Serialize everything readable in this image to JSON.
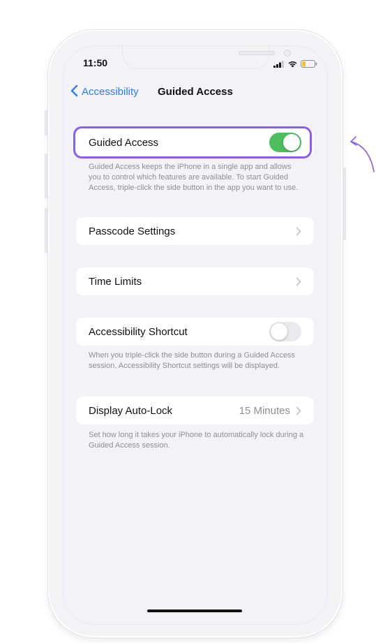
{
  "status_bar": {
    "time": "11:50"
  },
  "nav": {
    "back_label": "Accessibility",
    "title": "Guided Access"
  },
  "settings": {
    "guided_access": {
      "label": "Guided Access",
      "enabled": true,
      "footer": "Guided Access keeps the iPhone in a single app and allows you to control which features are available. To start Guided Access, triple-click the side button in the app you want to use."
    },
    "passcode_settings": {
      "label": "Passcode Settings"
    },
    "time_limits": {
      "label": "Time Limits"
    },
    "accessibility_shortcut": {
      "label": "Accessibility Shortcut",
      "enabled": false,
      "footer": "When you triple-click the side button during a Guided Access session, Accessibility Shortcut settings will be displayed."
    },
    "display_auto_lock": {
      "label": "Display Auto-Lock",
      "value": "15 Minutes",
      "footer": "Set how long it takes your iPhone to automatically lock during a Guided Access session."
    }
  },
  "colors": {
    "accent_link": "#2f7df6",
    "toggle_on": "#4cbf5c",
    "highlight": "#8b5cf6",
    "annotation": "#8b5cf6"
  },
  "icons": {
    "back": "chevron-left-icon",
    "disclosure": "chevron-right-icon",
    "signal": "cellular-signal-icon",
    "wifi": "wifi-icon",
    "battery": "battery-icon",
    "annotation": "curved-arrow-icon"
  }
}
